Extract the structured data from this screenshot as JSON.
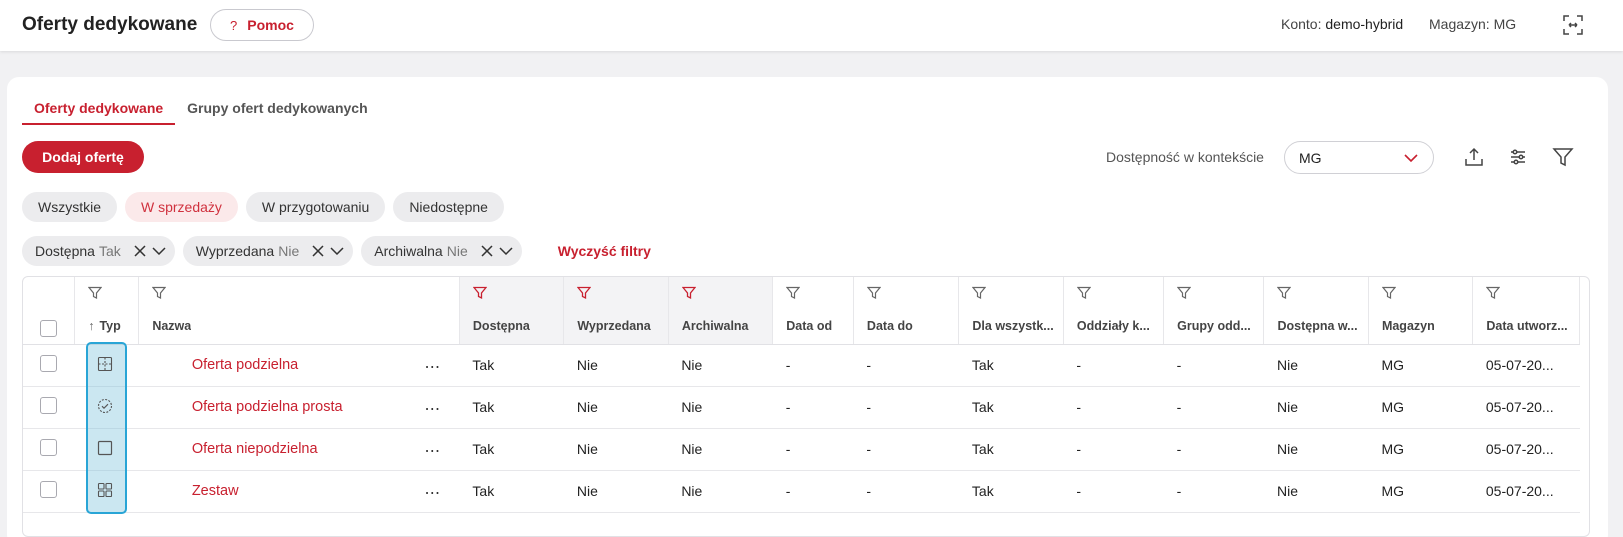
{
  "header": {
    "title": "Oferty dedykowane",
    "help_icon": "?",
    "help_label": "Pomoc",
    "account_label": "Konto:",
    "account_value": "demo-hybrid",
    "warehouse_label": "Magazyn:",
    "warehouse_value": "MG"
  },
  "tabs": [
    {
      "label": "Oferty dedykowane",
      "active": true
    },
    {
      "label": "Grupy ofert dedykowanych",
      "active": false
    }
  ],
  "toolbar": {
    "add_label": "Dodaj ofertę",
    "availability_label": "Dostępność w kontekście",
    "availability_value": "MG"
  },
  "status_chips": [
    {
      "label": "Wszystkie",
      "active": false
    },
    {
      "label": "W sprzedaży",
      "active": true
    },
    {
      "label": "W przygotowaniu",
      "active": false
    },
    {
      "label": "Niedostępne",
      "active": false
    }
  ],
  "active_filters": [
    {
      "label": "Dostępna",
      "value": "Tak"
    },
    {
      "label": "Wyprzedana",
      "value": "Nie"
    },
    {
      "label": "Archiwalna",
      "value": "Nie"
    }
  ],
  "clear_filters_label": "Wyczyść filtry",
  "table": {
    "columns": [
      "Typ",
      "Nazwa",
      "Dostępna",
      "Wyprzedana",
      "Archiwalna",
      "Data od",
      "Data do",
      "Dla wszystk...",
      "Oddziały k...",
      "Grupy odd...",
      "Dostępna w...",
      "Magazyn",
      "Data utworz..."
    ],
    "sort_icon": "↑",
    "rows": [
      {
        "type_icon": "split-grid-icon",
        "name": "Oferta podzielna",
        "cells": [
          "Tak",
          "Nie",
          "Nie",
          "-",
          "-",
          "Tak",
          "-",
          "-",
          "Nie",
          "MG",
          "05-07-20..."
        ]
      },
      {
        "type_icon": "check-circle-icon",
        "name": "Oferta podzielna prosta",
        "cells": [
          "Tak",
          "Nie",
          "Nie",
          "-",
          "-",
          "Tak",
          "-",
          "-",
          "Nie",
          "MG",
          "05-07-20..."
        ]
      },
      {
        "type_icon": "square-icon",
        "name": "Oferta niepodzielna",
        "cells": [
          "Tak",
          "Nie",
          "Nie",
          "-",
          "-",
          "Tak",
          "-",
          "-",
          "Nie",
          "MG",
          "05-07-20..."
        ]
      },
      {
        "type_icon": "four-squares-icon",
        "name": "Zestaw",
        "cells": [
          "Tak",
          "Nie",
          "Nie",
          "-",
          "-",
          "Tak",
          "-",
          "-",
          "Nie",
          "MG",
          "05-07-20..."
        ]
      }
    ],
    "row_menu": "⋯"
  },
  "colors": {
    "accent": "#c8202f",
    "chip_active_bg": "#fbe9ea",
    "highlight": "#29a5d6"
  }
}
